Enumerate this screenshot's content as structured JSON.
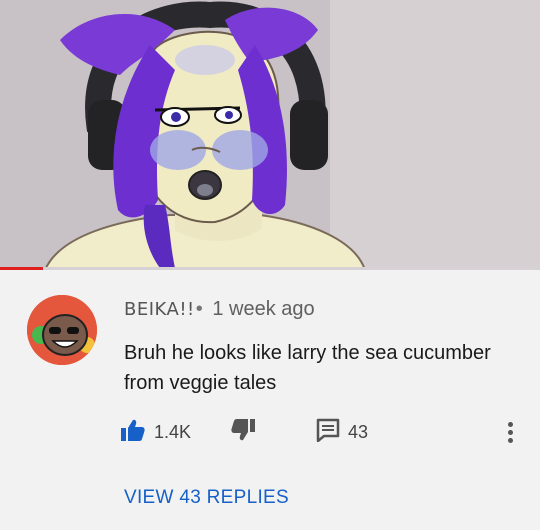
{
  "video": {
    "progress_fraction": 0.08,
    "progress_color": "#e01f1f"
  },
  "comment": {
    "author": "BEIKA!!",
    "separator": "•",
    "timestamp": "1 week ago",
    "text": "Bruh he looks like larry the sea cucumber from veggie tales",
    "likes": "1.4K",
    "reply_count": "43",
    "view_replies_label": "VIEW 43 REPLIES",
    "icons": {
      "like": "thumb-up-icon",
      "dislike": "thumb-down-icon",
      "reply": "comment-icon",
      "more": "more-vertical-icon"
    }
  },
  "colors": {
    "like_active": "#1660c8",
    "link": "#1660c8",
    "background": "#f2f2f2"
  }
}
